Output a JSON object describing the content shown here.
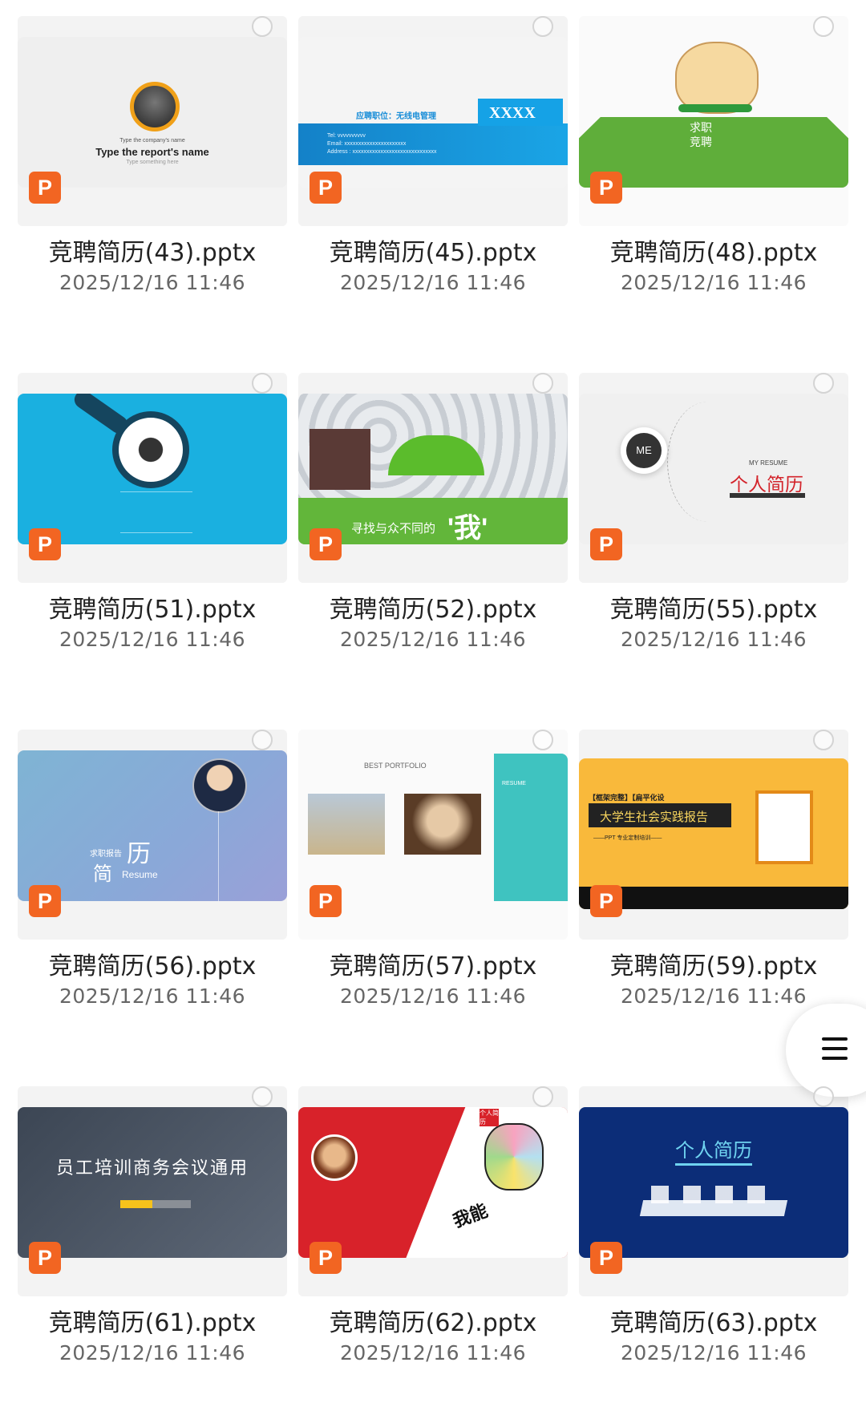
{
  "files": [
    {
      "name": "竞聘简历(43).pptx",
      "date": "2025/12/16 11:46"
    },
    {
      "name": "竞聘简历(45).pptx",
      "date": "2025/12/16 11:46"
    },
    {
      "name": "竞聘简历(48).pptx",
      "date": "2025/12/16 11:46"
    },
    {
      "name": "竞聘简历(51).pptx",
      "date": "2025/12/16 11:46"
    },
    {
      "name": "竞聘简历(52).pptx",
      "date": "2025/12/16 11:46"
    },
    {
      "name": "竞聘简历(55).pptx",
      "date": "2025/12/16 11:46"
    },
    {
      "name": "竞聘简历(56).pptx",
      "date": "2025/12/16 11:46"
    },
    {
      "name": "竞聘简历(57).pptx",
      "date": "2025/12/16 11:46"
    },
    {
      "name": "竞聘简历(59).pptx",
      "date": "2025/12/16 11:46"
    },
    {
      "name": "竞聘简历(61).pptx",
      "date": "2025/12/16 11:46"
    },
    {
      "name": "竞聘简历(62).pptx",
      "date": "2025/12/16 11:46"
    },
    {
      "name": "竞聘简历(63).pptx",
      "date": "2025/12/16 11:46"
    }
  ],
  "badge_letter": "P",
  "thumb_text": {
    "t43_small": "Type the company's name",
    "t43_title": "Type the report's name",
    "t43_sub": "Type something here",
    "t45_position": "应聘职位：无线电管理",
    "t45_box": "XXXX",
    "t45_tel": "Tel: vvvvvvvvvv",
    "t45_email": "Email: xxxxxxxxxxxxxxxxxxxxxx",
    "t45_address": "Address : xxxxxxxxxxxxxxxxxxxxxxxxxxxxxx",
    "t48_title": "求职竞聘",
    "t52_text": "寻找与众不同的",
    "t52_big": "'我'",
    "t55_me": "ME",
    "t55_myresume": "MY RESUME",
    "t55_title": "个人简历",
    "t56_a": "求职报告",
    "t56_b": "简",
    "t56_c": "历",
    "t56_d": "Resume",
    "t57_title": "BEST PORTFOLIO",
    "t57_side": "RESUME",
    "t59_tag": "【框架完整】【扁平化设",
    "t59_title": "大学生社会实践报告",
    "t59_sub": "——PPT 专业定制培训——",
    "t61_title": "员工培训商务会议通用",
    "t62_text": "我能",
    "t62_corner": "个人简历",
    "t63_title": "个人简历"
  },
  "colors": {
    "ppt_orange": "#f26522",
    "cyan": "#1ab0e0",
    "green": "#5fae3a",
    "teal": "#3fc3c0",
    "yellow": "#f9b93b",
    "red": "#d8222a",
    "navy": "#0c2d78"
  }
}
